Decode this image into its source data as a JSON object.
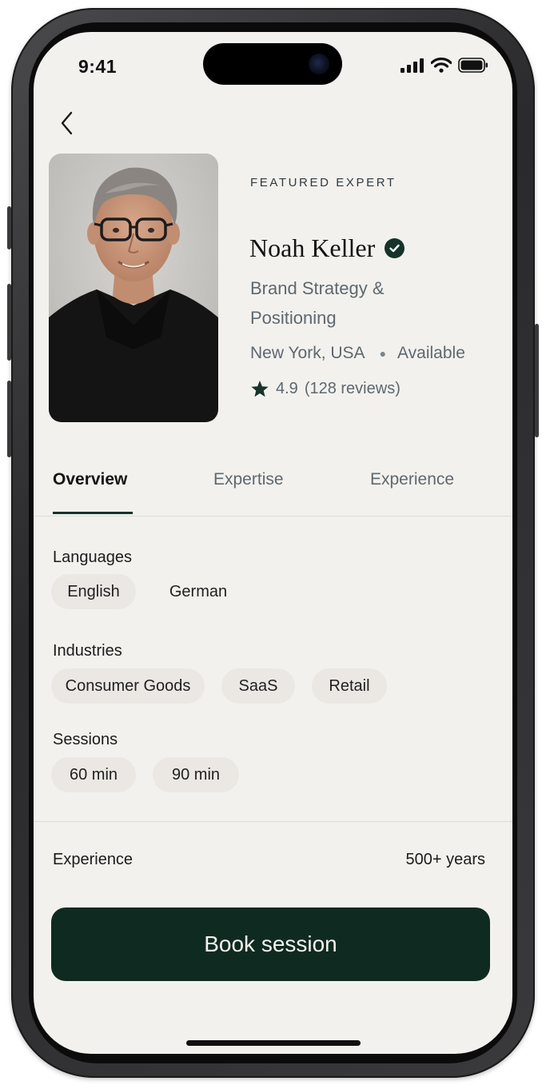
{
  "status_bar": {
    "time": "9:41"
  },
  "header": {
    "back_icon": "chevron-left-icon"
  },
  "profile": {
    "eyebrow": "FEATURED EXPERT",
    "name": "Noah Keller",
    "verified_icon": "check-badge-icon",
    "specialty": "Brand Strategy & Positioning",
    "location": "New York, USA",
    "availability": "Available",
    "rating": "4.9",
    "reviews": "(128 reviews)"
  },
  "tabs": [
    {
      "label": "Overview",
      "active": true
    },
    {
      "label": "Expertise",
      "active": false
    },
    {
      "label": "Experience",
      "active": false
    }
  ],
  "overview": {
    "languages_label": "Languages",
    "languages": [
      "English",
      "German"
    ],
    "industries_label": "Industries",
    "industries": [
      "Consumer Goods",
      "SaaS",
      "Retail"
    ],
    "sessions_label": "Sessions",
    "sessions": [
      "60 min",
      "90 min"
    ],
    "experience_label": "Experience",
    "experience_value": "500+ years"
  },
  "cta": {
    "label": "Book session"
  },
  "colors": {
    "accent": "#0f2a21",
    "background": "#f3f1ee",
    "chip": "#ebe8e4",
    "muted_text": "#5d6870"
  }
}
